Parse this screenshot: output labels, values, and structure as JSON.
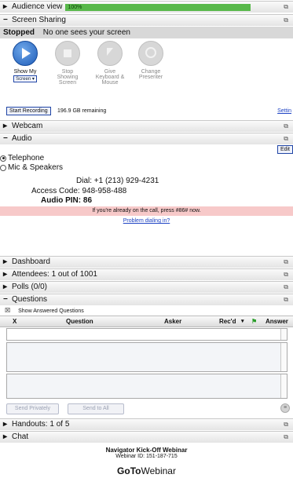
{
  "audience_view": {
    "label": "Audience view",
    "progress_text": "100%",
    "progress": 1.0
  },
  "screen_sharing": {
    "title": "Screen Sharing",
    "status_label": "Stopped",
    "status_text": "No one sees your screen",
    "tools": [
      {
        "label": "Show My",
        "select": "Screen ▾"
      },
      {
        "label": "Stop Showing Screen"
      },
      {
        "label": "Give Keyboard & Mouse"
      },
      {
        "label": "Change Presenter"
      }
    ],
    "start_recording": "Start Recording",
    "remaining": "196.9 GB remaining",
    "settings": "Settin"
  },
  "webcam": {
    "title": "Webcam"
  },
  "audio": {
    "title": "Audio",
    "edit": "Edit",
    "options": [
      "Telephone",
      "Mic & Speakers"
    ],
    "dial": "Dial: +1 (213) 929-4231",
    "access_code": "Access Code: 948-958-488",
    "audio_pin": "Audio PIN: 86",
    "notice": "If you're already on the call, press #86# now.",
    "problem_link": "Problem dialing in?"
  },
  "dashboard": {
    "title": "Dashboard"
  },
  "attendees": {
    "title": "Attendees: 1 out of 1001"
  },
  "polls": {
    "title": "Polls (0/0)"
  },
  "questions": {
    "title": "Questions",
    "show_answered": "Show Answered Questions",
    "columns": [
      "X",
      "Question",
      "Asker",
      "Rec'd",
      "Answer"
    ],
    "send_privately": "Send Privately",
    "send_to_all": "Send to All"
  },
  "handouts": {
    "title": "Handouts: 1 of 5"
  },
  "chat": {
    "title": "Chat"
  },
  "footer": {
    "webinar_title": "Navigator Kick-Off Webinar",
    "webinar_id": "Webinar ID: 151-187-715"
  },
  "logo": {
    "goto": "GoTo",
    "webinar": "Webinar"
  },
  "colors": {
    "progress": "#58b84a",
    "notice_bg": "#f7c9c9",
    "link": "#1f44c4",
    "play_button": "#1e5cb8"
  }
}
